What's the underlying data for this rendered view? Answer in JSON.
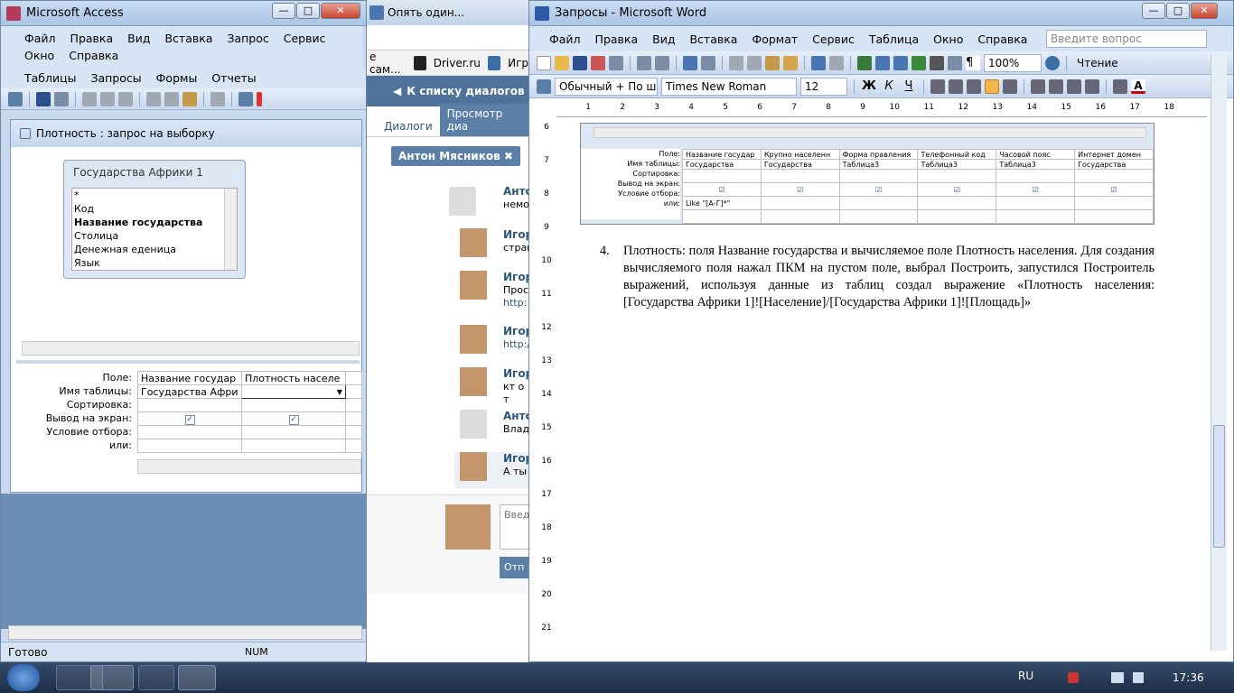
{
  "access": {
    "title": "Microsoft Access",
    "menu": [
      "Файл",
      "Правка",
      "Вид",
      "Вставка",
      "Запрос",
      "Сервис",
      "Окно",
      "Справка"
    ],
    "menu2": [
      "Таблицы",
      "Запросы",
      "Формы",
      "Отчеты"
    ],
    "query_title": "Плотность : запрос на выборку",
    "table_box_title": "Государства Африки 1",
    "fields": [
      "*",
      "Код",
      "Название государства",
      "Столица",
      "Денежная еденица",
      "Язык"
    ],
    "row_labels": [
      "Поле:",
      "Имя таблицы:",
      "Сортировка:",
      "Вывод на экран:",
      "Условие отбора:",
      "или:"
    ],
    "col1": {
      "field": "Название государ",
      "table": "Государства Афри"
    },
    "col2": {
      "field": "Плотность населе",
      "table": ""
    },
    "status": "Готово",
    "num": "NUM"
  },
  "browser": {
    "tab1": "Опять один...",
    "bookmarks": [
      "е сам...",
      "Driver.ru",
      "Игр"
    ],
    "back_link": "К списку диалогов",
    "tabs": [
      "Диалоги",
      "Просмотр диа"
    ],
    "chip": "Антон Мясников",
    "messages": [
      {
        "name": "Анто",
        "text": "немо"
      },
      {
        "name": "Игор",
        "text": "стран"
      },
      {
        "name": "Игор",
        "text": "Прось",
        "link": "http:"
      },
      {
        "name": "Игор",
        "text": "http:/"
      },
      {
        "name": "Игор",
        "text": "кт о т"
      },
      {
        "name": "Анто",
        "text": "Влади"
      },
      {
        "name": "Игор",
        "text": "А ты"
      }
    ],
    "input_placeholder": "Введ",
    "send_button": "Отп"
  },
  "word": {
    "title": "Запросы - Microsoft Word",
    "menu": [
      "Файл",
      "Правка",
      "Вид",
      "Вставка",
      "Формат",
      "Сервис",
      "Таблица",
      "Окно",
      "Справка"
    ],
    "ask_placeholder": "Введите вопрос",
    "zoom": "100%",
    "read_button": "Чтение",
    "style": "Обычный + По ш",
    "font": "Times New Roman",
    "size": "12",
    "ruler_numbers": [
      "1",
      "2",
      "3",
      "4",
      "5",
      "6",
      "7",
      "8",
      "9",
      "10",
      "11",
      "12",
      "13",
      "14",
      "15",
      "16",
      "17",
      "18"
    ],
    "vruler_numbers": [
      "6",
      "7",
      "8",
      "9",
      "10",
      "11",
      "12",
      "13",
      "14",
      "15",
      "16",
      "17",
      "18",
      "19",
      "20",
      "21"
    ],
    "embedded": {
      "row_labels": [
        "Поле:",
        "Имя таблицы:",
        "Сортировка:",
        "Вывод на экран:",
        "Условие отбора:",
        "или:"
      ],
      "fields": [
        "Название государ",
        "Крупно населенн",
        "Форма правления",
        "Телефонный код",
        "Часовой пояс",
        "Интернет домен"
      ],
      "tables": [
        "Государства",
        "Государства",
        "Таблица3",
        "Таблица3",
        "Таблица3",
        "Государства"
      ],
      "criteria": "Like \"[А-Г]*\""
    },
    "list_number": "4.",
    "paragraph": "Плотность: поля Название государства и вычисляемое поле Плотность населения. Для создания вычисляемого поля нажал ПКМ на пустом поле, выбрал Построить, запустился Построитель выражений, используя данные из таблиц создал выражение «Плотность населения: [Государства Африки 1]![Население]/[Государства Африки 1]![Площадь]»"
  },
  "taskbar": {
    "lang": "RU",
    "clock": "17:36"
  }
}
